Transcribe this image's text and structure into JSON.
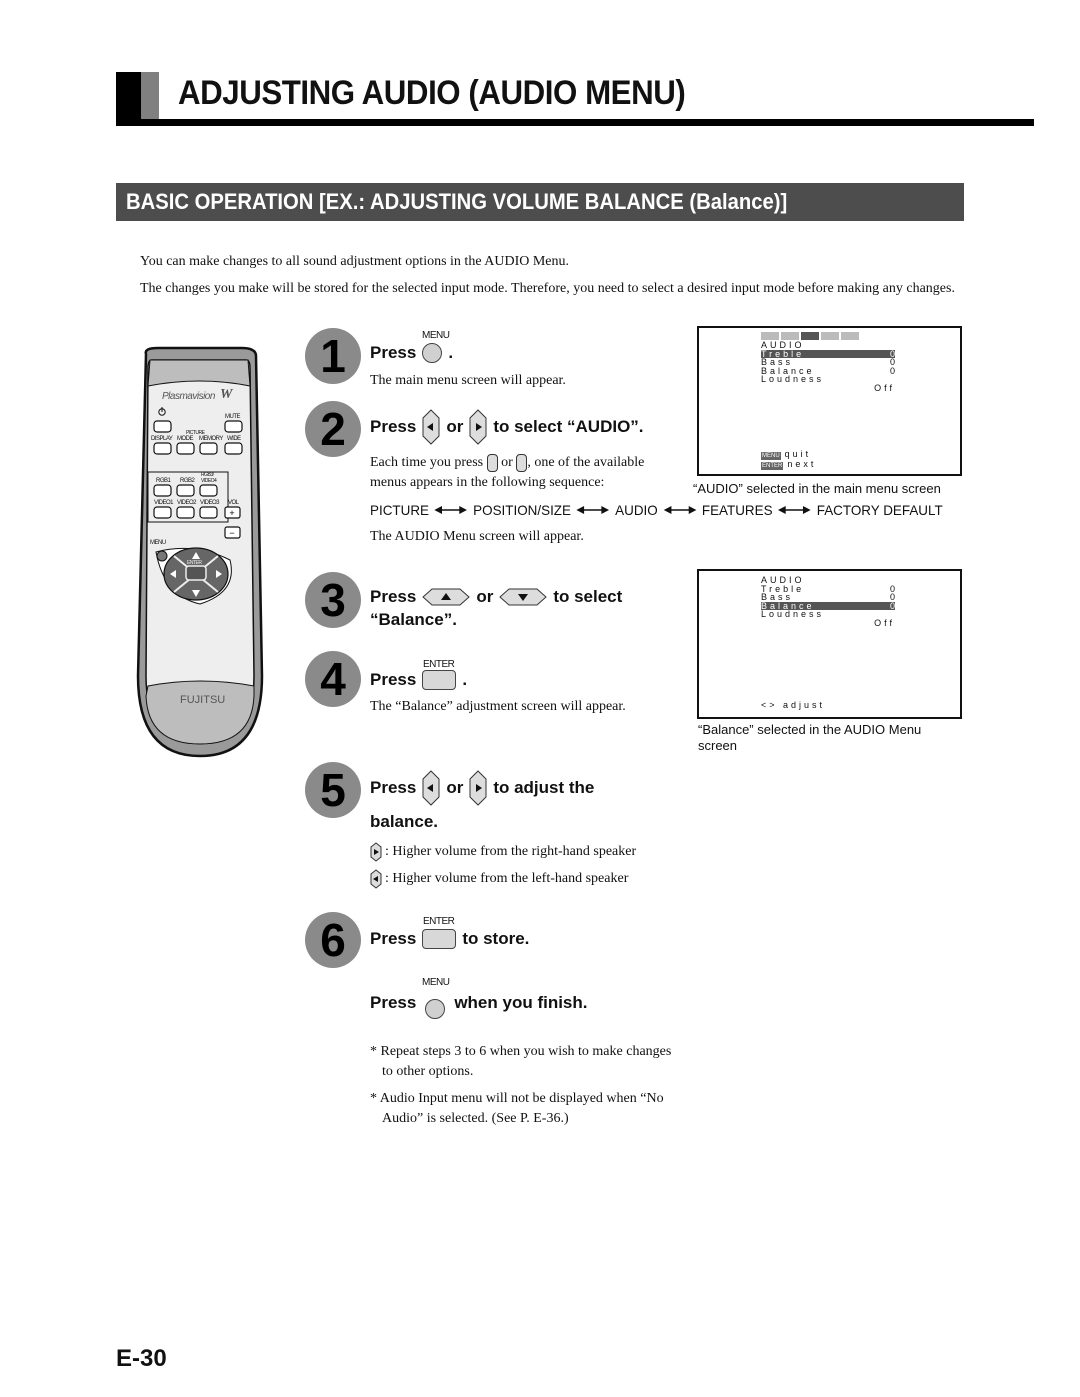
{
  "header": {
    "title": "ADJUSTING AUDIO (AUDIO MENU)",
    "section": "BASIC OPERATION [EX.: ADJUSTING VOLUME BALANCE (Balance)]"
  },
  "intro": [
    "You can make changes to all sound adjustment options in the AUDIO Menu.",
    "The changes you make will be stored for the selected input mode.  Therefore, you need to select a desired input mode before making any changes."
  ],
  "remote": {
    "brand": "Plasmavision",
    "brand_mark": "W",
    "manufacturer": "FUJITSU",
    "buttons": {
      "mute": "MUTE",
      "display": "DISPLAY",
      "picture_group": "PICTURE",
      "mode": "MODE",
      "memory": "MEMORY",
      "wide": "WIDE",
      "rgb1": "RGB1",
      "rgb2": "RGB2",
      "rgb3": "RGB3/ VIDEO4",
      "video1": "VIDEO1",
      "video2": "VIDEO2",
      "video3": "VIDEO3",
      "vol": "VOL",
      "plus": "+",
      "minus": "−",
      "menu": "MENU",
      "enter": "ENTER"
    }
  },
  "steps": [
    {
      "num": "1",
      "press": "Press",
      "btn_label": "MENU",
      "after": ".",
      "desc": "The main menu screen will appear."
    },
    {
      "num": "2",
      "press": "Press",
      "or": "or",
      "after": "to select “AUDIO”.",
      "desc_a": "Each time you press",
      "desc_or": "or",
      "desc_b": ", one of the available menus appears in the following sequence:",
      "desc2": "The AUDIO Menu screen will appear."
    },
    {
      "num": "3",
      "press": "Press",
      "or": "or",
      "after": "to select",
      "after2": "“Balance”."
    },
    {
      "num": "4",
      "press": "Press",
      "btn_label": "ENTER",
      "after": ".",
      "desc": "The “Balance” adjustment screen will appear."
    },
    {
      "num": "5",
      "press": "Press",
      "or": "or",
      "after": "to adjust the",
      "after2": "balance.",
      "right_desc": ": Higher volume from the right-hand speaker",
      "left_desc": ": Higher volume from the left-hand speaker"
    },
    {
      "num": "6",
      "press": "Press",
      "btn_label": "ENTER",
      "after": "to store.",
      "press2": "Press",
      "btn_label2": "MENU",
      "after2": "when you finish."
    }
  ],
  "sequence": [
    "PICTURE",
    "POSITION/SIZE",
    "AUDIO",
    "FEATURES",
    "FACTORY DEFAULT"
  ],
  "notes": [
    "* Repeat steps 3 to 6 when you wish to make changes to other options.",
    "* Audio Input menu will not be displayed when “No Audio” is selected. (See P. E-36.)"
  ],
  "screen1": {
    "menu_title": "AUDIO",
    "items": [
      {
        "label": "Treble",
        "value": "0",
        "selected": true
      },
      {
        "label": "Bass",
        "value": "0",
        "selected": false
      },
      {
        "label": "Balance",
        "value": "0",
        "selected": false
      },
      {
        "label": "Loudness",
        "value": "",
        "selected": false
      }
    ],
    "loudness_value": "Off",
    "footer": [
      {
        "key": "MENU",
        "text": "quit"
      },
      {
        "key": "ENTER",
        "text": "next"
      }
    ],
    "caption": "“AUDIO” selected in the main menu screen"
  },
  "screen2": {
    "menu_title": "AUDIO",
    "items": [
      {
        "label": "Treble",
        "value": "0",
        "selected": false
      },
      {
        "label": "Bass",
        "value": "0",
        "selected": false
      },
      {
        "label": "Balance",
        "value": "0",
        "selected": true
      },
      {
        "label": "Loudness",
        "value": "",
        "selected": false
      }
    ],
    "loudness_value": "Off",
    "footer": "<> adjust",
    "caption": "“Balance” selected in the AUDIO Menu screen"
  },
  "page_number": "E-30"
}
